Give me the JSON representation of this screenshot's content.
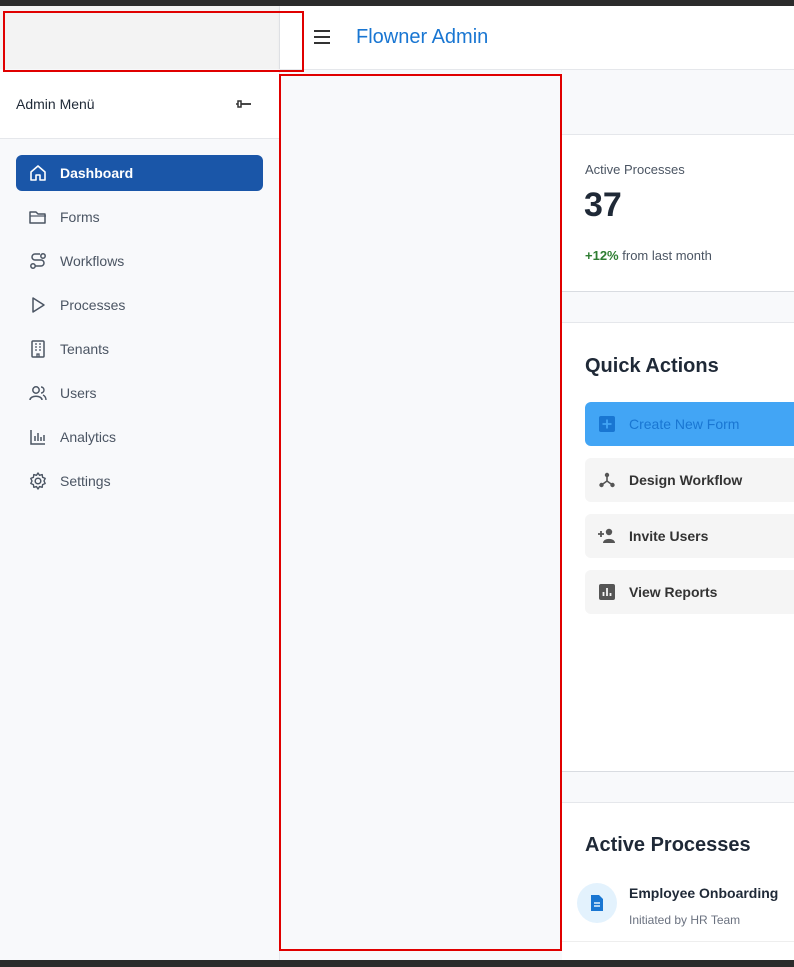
{
  "header": {
    "app_title": "Flowner Admin"
  },
  "sidebar": {
    "title": "Admin Menü",
    "items": [
      {
        "label": "Dashboard",
        "icon": "home-icon",
        "active": true
      },
      {
        "label": "Forms",
        "icon": "folder-icon"
      },
      {
        "label": "Workflows",
        "icon": "route-icon"
      },
      {
        "label": "Processes",
        "icon": "play-icon"
      },
      {
        "label": "Tenants",
        "icon": "building-icon"
      },
      {
        "label": "Users",
        "icon": "users-icon"
      },
      {
        "label": "Analytics",
        "icon": "bar-chart-icon"
      },
      {
        "label": "Settings",
        "icon": "gear-icon"
      }
    ]
  },
  "stats": {
    "label": "Active Processes",
    "value": "37",
    "change": "+12%",
    "change_suffix": "from last month"
  },
  "quick_actions": {
    "title": "Quick Actions",
    "items": [
      {
        "label": "Create New Form",
        "icon": "plus-box-icon",
        "primary": true
      },
      {
        "label": "Design Workflow",
        "icon": "hub-icon"
      },
      {
        "label": "Invite Users",
        "icon": "person-add-icon"
      },
      {
        "label": "View Reports",
        "icon": "report-icon"
      }
    ]
  },
  "active_processes": {
    "title": "Active Processes",
    "items": [
      {
        "name": "Employee Onboarding",
        "initiator": "Initiated by HR Team",
        "icon": "document-icon"
      }
    ]
  },
  "colors": {
    "accent": "#1976d2",
    "active_nav": "#1a56a8",
    "primary_action": "#42a5f5",
    "positive": "#2e7d32",
    "highlight": "#e00000"
  }
}
